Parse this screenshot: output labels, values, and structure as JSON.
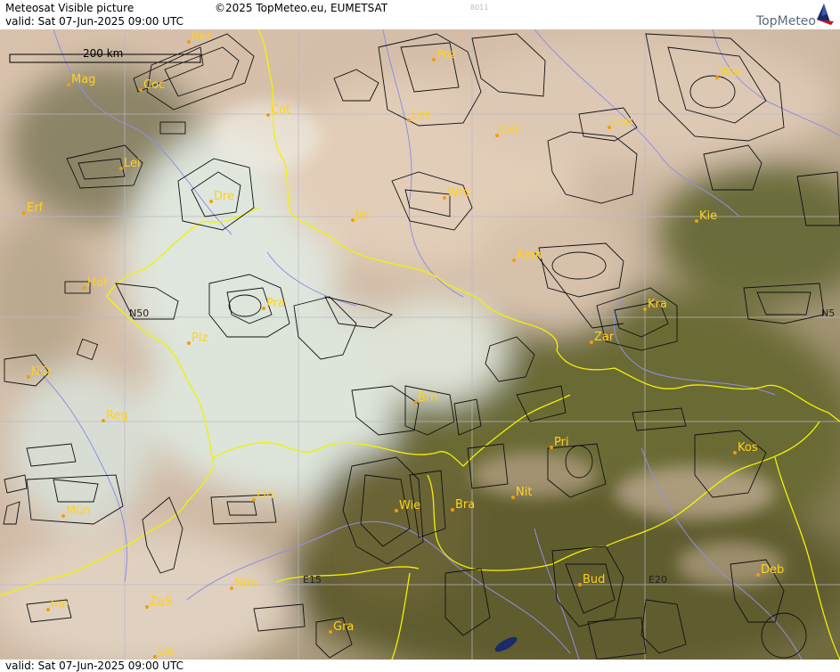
{
  "header": {
    "title": "Meteosat Visible picture",
    "copyright": "©2025 TopMeteo.eu, EUMETSAT",
    "valid": "valid:  Sat  07-Jun-2025  09:00 UTC",
    "code": "8011",
    "brand": "TopMeteo"
  },
  "footer": {
    "valid": "valid:  Sat  07-Jun-2025  09:00 UTC"
  },
  "map": {
    "scale_label": "200 km",
    "grid_labels": [
      "N50",
      "E15",
      "E20",
      "N5"
    ],
    "cities": [
      "Ber",
      "Mag",
      "Coc",
      "Cot",
      "Poz",
      "War",
      "Les",
      "Lod",
      "Ost",
      "Lei",
      "Dre",
      "Erf",
      "Wro",
      "Jel",
      "Kie",
      "Kam",
      "Hof",
      "Pra",
      "Kra",
      "Zar",
      "Plz",
      "Nür",
      "Brn",
      "Reg",
      "Pri",
      "Kos",
      "Lin",
      "Wie",
      "Bra",
      "Nit",
      "Mün",
      "Nöb",
      "E15",
      "Bud",
      "E20",
      "Deb",
      "Inn",
      "ZaS",
      "Gra",
      "Lie"
    ],
    "colors": {
      "border": "#f2f200",
      "river": "#8f8fe6",
      "contour": "#111111",
      "label": "#ffd21a"
    }
  }
}
